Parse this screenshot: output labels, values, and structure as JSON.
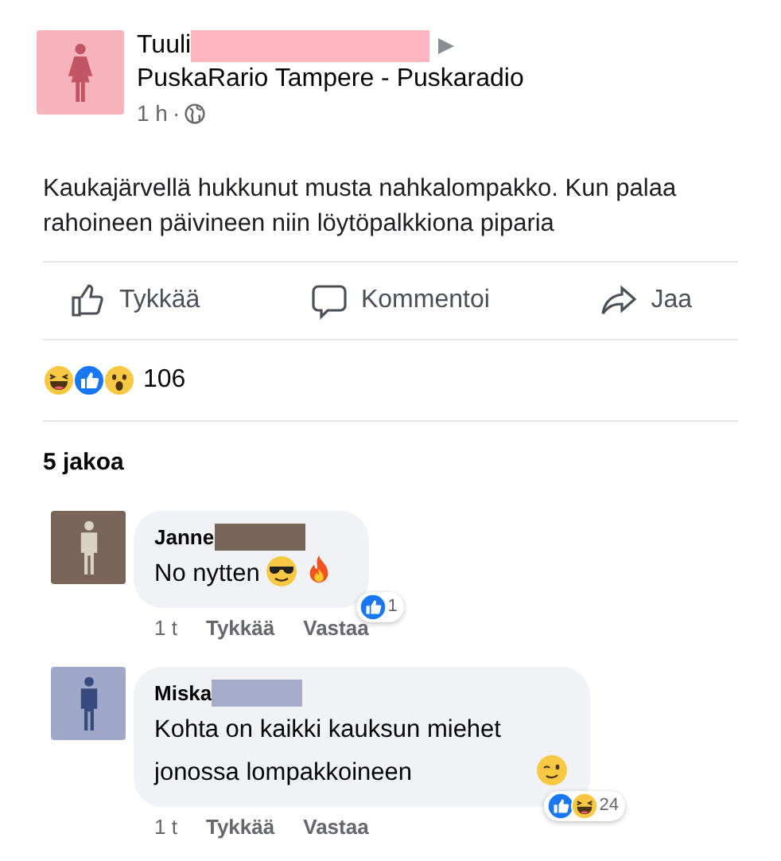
{
  "post": {
    "author": {
      "first_name": "Tuuli",
      "avatar": {
        "kind": "woman",
        "color": "#f7b3bb",
        "figure": {
          "color": "#c25564"
        }
      },
      "redaction": {
        "color": "#ffb6be"
      }
    },
    "group": "PuskaRario Tampere - Puskaradio",
    "time": "1 h",
    "separator": "·",
    "text": "Kaukajärvellä hukkunut musta nahkalompakko. Kun palaa rahoineen päivineen niin löytöpalkkiona piparia",
    "actions": [
      {
        "kind": "like",
        "label": "Tykkää"
      },
      {
        "kind": "comment",
        "label": "Kommentoi"
      },
      {
        "kind": "share",
        "label": "Jaa"
      }
    ],
    "reactions": [
      {
        "kind": "haha"
      },
      {
        "kind": "like"
      },
      {
        "kind": "wow"
      }
    ],
    "reaction_count": "106",
    "shares": "5 jakoa"
  },
  "comments": [
    {
      "author": {
        "first_name": "Janne",
        "avatar": {
          "kind": "man",
          "color": "#786557",
          "figure": {
            "color": "#d9d3c4"
          }
        },
        "redaction": {
          "color": "#786557"
        }
      },
      "text": "No nytten",
      "emojis": [
        {
          "kind": "sunglasses"
        },
        {
          "kind": "fire"
        }
      ],
      "reactions": [
        {
          "kind": "like"
        }
      ],
      "reaction_count": "1",
      "time": "1 t",
      "like": "Tykkää",
      "reply": "Vastaa"
    },
    {
      "author": {
        "first_name": "Miska",
        "avatar": {
          "kind": "man",
          "color": "#9fa8c9",
          "figure": {
            "color": "#394a7e"
          }
        },
        "redaction": {
          "color": "#a4acca"
        }
      },
      "text": "Kohta on kaikki kauksun miehet jonossa lompakkoineen",
      "emojis": [
        {
          "kind": "wink"
        }
      ],
      "reactions": [
        {
          "kind": "like"
        },
        {
          "kind": "haha"
        }
      ],
      "reaction_count": "24",
      "time": "1 t",
      "like": "Tykkää",
      "reply": "Vastaa"
    }
  ]
}
